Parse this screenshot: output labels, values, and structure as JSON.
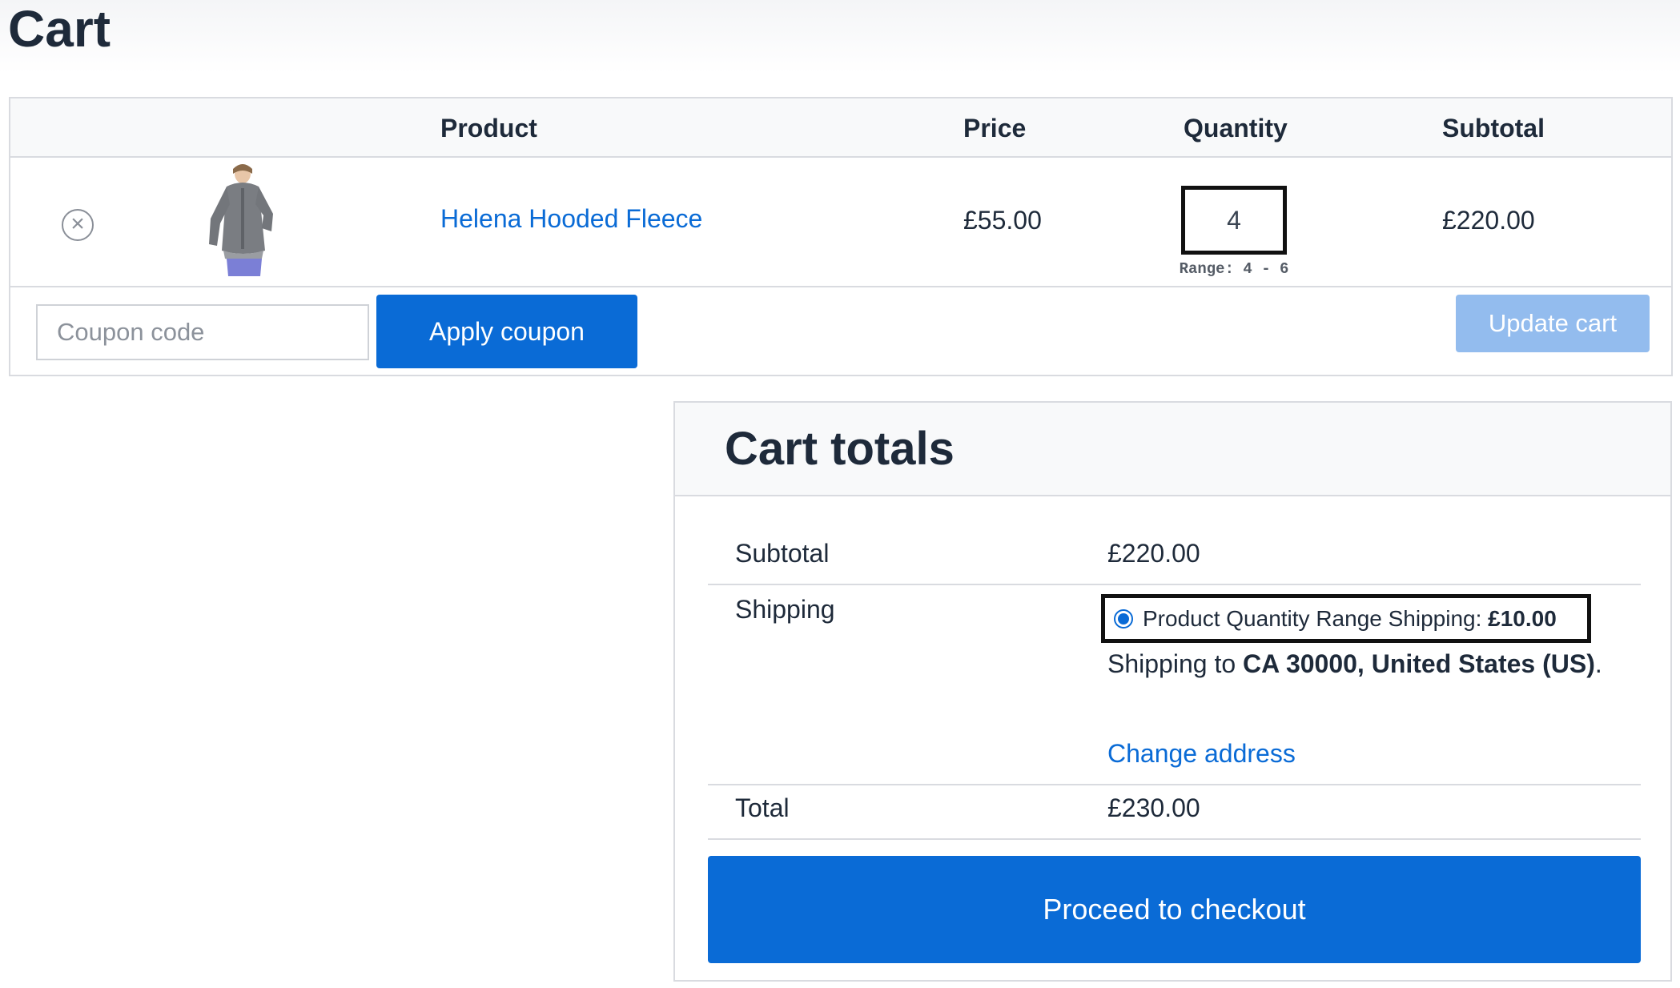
{
  "page": {
    "title": "Cart"
  },
  "table": {
    "headers": {
      "product": "Product",
      "price": "Price",
      "quantity": "Quantity",
      "subtotal": "Subtotal"
    },
    "rows": [
      {
        "remove_icon": "close-circle-icon",
        "image_desc": "product-thumbnail",
        "product": "Helena Hooded Fleece",
        "price": "£55.00",
        "quantity": "4",
        "range": "Range: 4 - 6",
        "subtotal": "£220.00"
      }
    ]
  },
  "coupon": {
    "placeholder": "Coupon code",
    "apply_label": "Apply coupon"
  },
  "update_label": "Update cart",
  "totals": {
    "title": "Cart totals",
    "subtotal_label": "Subtotal",
    "subtotal_value": "£220.00",
    "shipping_label": "Shipping",
    "shipping_method": "Product Quantity Range Shipping: ",
    "shipping_cost": "£10.00",
    "shipping_to_prefix": "Shipping to ",
    "shipping_to_bold": "CA 30000, United States (US)",
    "shipping_to_suffix": ".",
    "change_address": "Change address",
    "total_label": "Total",
    "total_value": "£230.00",
    "checkout_label": "Proceed to checkout"
  },
  "colors": {
    "accent": "#0a6bd6",
    "disabled_button": "#93bcee",
    "text": "#1e2a3a",
    "border": "#d9dbe0"
  }
}
